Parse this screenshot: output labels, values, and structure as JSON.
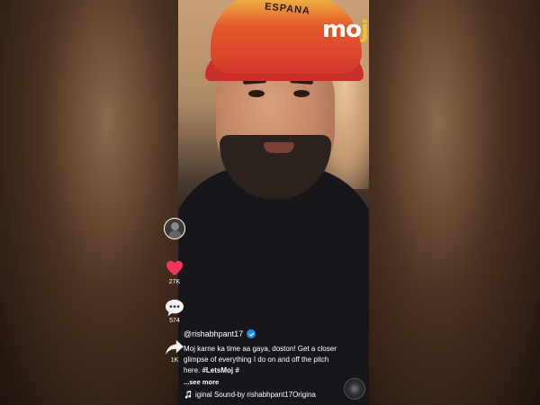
{
  "app": {
    "logo_text_mo": "mo",
    "logo_text_j": "j"
  },
  "cap_text": "ESPANA",
  "creator": {
    "handle": "@rishabhpant17",
    "verified": true
  },
  "post": {
    "description": "Moj karne ka time aa gaya, doston! Get a closer glimpse of everything I do on and off the pitch here.",
    "hashtag": "#LetsMoj #",
    "see_more": "...see more",
    "sound": "iginal Sound-by rishabhpant17Origina"
  },
  "actions": {
    "likes": "27K",
    "comments": "574",
    "shares": "1K"
  },
  "colors": {
    "like": "#f2365a",
    "verified": "#1f8cf0",
    "logo_accent": "#f2c32a"
  },
  "icons": [
    "heart-icon",
    "comment-icon",
    "share-icon",
    "music-note-icon",
    "verified-icon"
  ]
}
